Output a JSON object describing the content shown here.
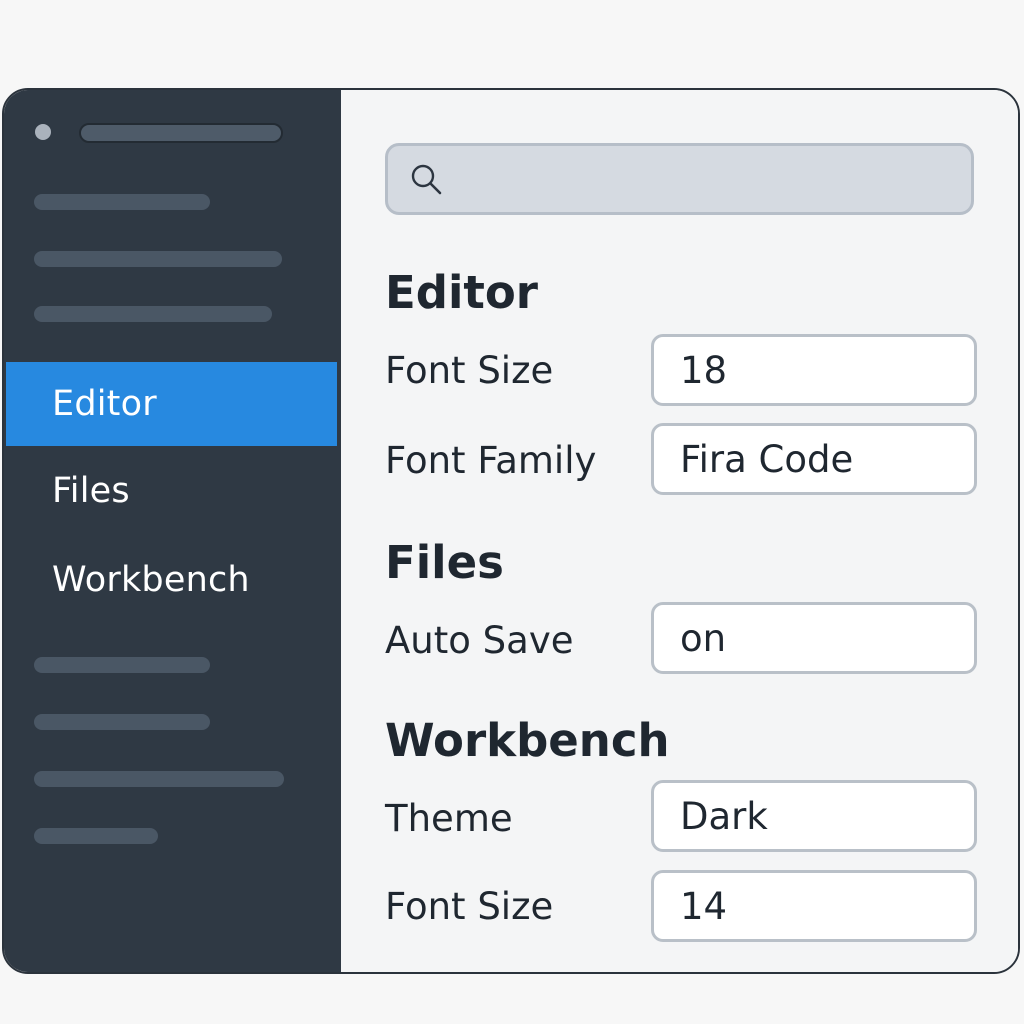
{
  "sidebar": {
    "items": [
      {
        "label": "Editor",
        "active": true
      },
      {
        "label": "Files",
        "active": false
      },
      {
        "label": "Workbench",
        "active": false
      }
    ]
  },
  "search": {
    "icon": "search-icon",
    "value": "",
    "placeholder": ""
  },
  "sections": {
    "editor": {
      "title": "Editor",
      "font_size_label": "Font Size",
      "font_size_value": "18",
      "font_family_label": "Font Family",
      "font_family_value": "Fira Code"
    },
    "files": {
      "title": "Files",
      "auto_save_label": "Auto Save",
      "auto_save_value": "on"
    },
    "workbench": {
      "title": "Workbench",
      "theme_label": "Theme",
      "theme_value": "Dark",
      "font_size_label": "Font Size",
      "font_size_value": "14"
    }
  },
  "colors": {
    "sidebar_bg": "#2f3944",
    "accent": "#2789e0",
    "content_bg": "#f4f5f6"
  }
}
